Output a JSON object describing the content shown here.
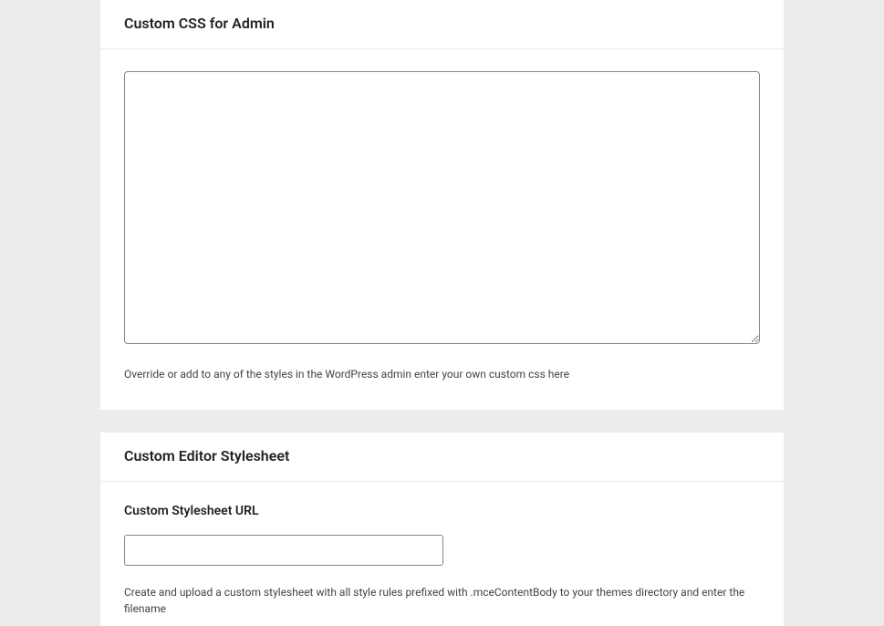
{
  "sections": {
    "customCssAdmin": {
      "title": "Custom CSS for Admin",
      "textarea_value": "",
      "help_text": "Override or add to any of the styles in the WordPress admin enter your own custom css here"
    },
    "customEditorStylesheet": {
      "title": "Custom Editor Stylesheet",
      "field_label": "Custom Stylesheet URL",
      "input_value": "",
      "help_text": "Create and upload a custom stylesheet with all style rules prefixed with .mceContentBody to your themes directory and enter the filename"
    }
  }
}
